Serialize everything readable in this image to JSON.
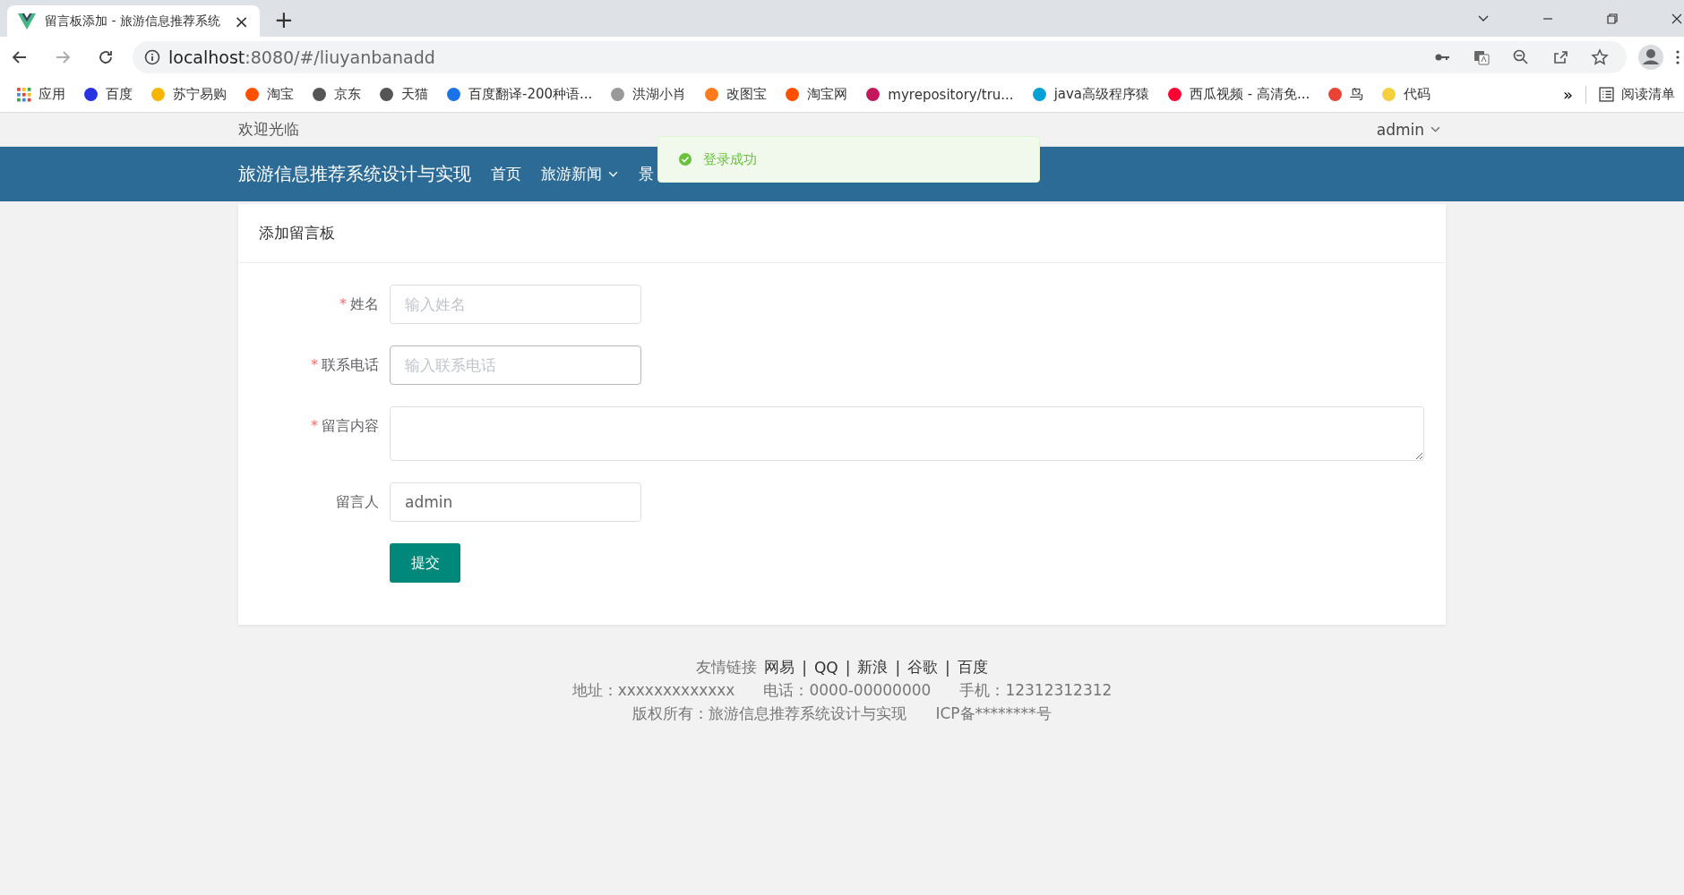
{
  "browser": {
    "tab": {
      "title": "留言板添加 - 旅游信息推荐系统",
      "close": "×"
    },
    "new_tab": "+",
    "address": {
      "host": "localhost",
      "path": ":8080/#/liuyanbanadd"
    },
    "bookmarks": [
      {
        "label": "应用"
      },
      {
        "label": "百度"
      },
      {
        "label": "苏宁易购"
      },
      {
        "label": "淘宝"
      },
      {
        "label": "京东"
      },
      {
        "label": "天猫"
      },
      {
        "label": "百度翻译-200种语..."
      },
      {
        "label": "洪湖小肖"
      },
      {
        "label": "改图宝"
      },
      {
        "label": "淘宝网"
      },
      {
        "label": "myrepository/tru..."
      },
      {
        "label": "java高级程序猿"
      },
      {
        "label": "西瓜视频 - 高清免..."
      },
      {
        "label": "鸟"
      },
      {
        "label": "代码"
      }
    ],
    "more": "»",
    "reading_list": "阅读清单"
  },
  "topbar": {
    "welcome": "欢迎光临",
    "user": "admin"
  },
  "nav": {
    "title": "旅游信息推荐系统设计与实现",
    "items": [
      {
        "label": "首页",
        "dropdown": false
      },
      {
        "label": "旅游新闻",
        "dropdown": true
      },
      {
        "label": "景",
        "dropdown": false
      }
    ]
  },
  "toast": {
    "message": "登录成功"
  },
  "card": {
    "title": "添加留言板",
    "required_mark": "*",
    "fields": [
      {
        "label": "姓名",
        "required": true,
        "kind": "input",
        "placeholder": "输入姓名"
      },
      {
        "label": "联系电话",
        "required": true,
        "kind": "input",
        "placeholder": "输入联系电话"
      },
      {
        "label": "留言内容",
        "required": true,
        "kind": "textarea"
      },
      {
        "label": "留言人",
        "required": false,
        "kind": "input",
        "value": "admin"
      }
    ],
    "submit": "提交"
  },
  "footer": {
    "links_label": "友情链接",
    "links": [
      "网易",
      "QQ",
      "新浪",
      "谷歌",
      "百度"
    ],
    "separator": "|",
    "line2": [
      "地址：xxxxxxxxxxxxx",
      "电话：0000-00000000",
      "手机：12312312312"
    ],
    "line3": [
      "版权所有：旅游信息推荐系统设计与实现",
      "ICP备********号"
    ]
  }
}
